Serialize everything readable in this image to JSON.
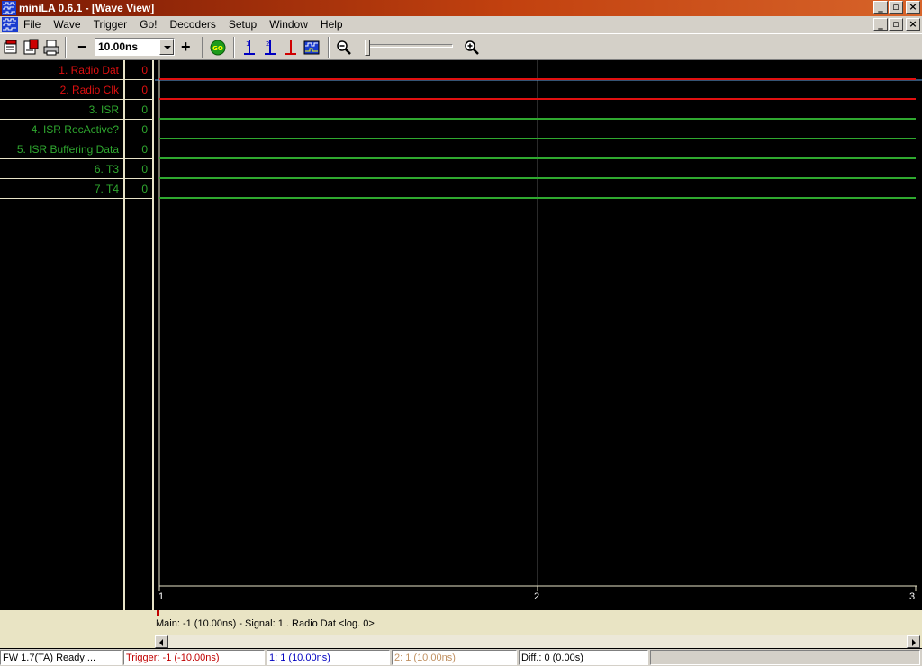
{
  "window": {
    "title": "miniLA 0.6.1 - [Wave View]",
    "buttons": {
      "minimize": "_",
      "restore": "▫",
      "close": "×"
    }
  },
  "menu": {
    "items": [
      "File",
      "Wave",
      "Trigger",
      "Go!",
      "Decoders",
      "Setup",
      "Window",
      "Help"
    ]
  },
  "toolbar": {
    "zoom_value": "10.00ns",
    "minus_label": "−",
    "plus_label": "+",
    "go_label": "GO",
    "cursor1_label": "1",
    "cursor2_label": "2"
  },
  "signals": [
    {
      "name": "1. Radio Dat",
      "value": "0",
      "color": "#e01010"
    },
    {
      "name": "2. Radio Clk",
      "value": "0",
      "color": "#e01010"
    },
    {
      "name": "3. ISR",
      "value": "0",
      "color": "#2fa82f"
    },
    {
      "name": "4. ISR RecActive?",
      "value": "0",
      "color": "#2fa82f"
    },
    {
      "name": "5. ISR Buffering Data",
      "value": "0",
      "color": "#2fa82f"
    },
    {
      "name": "6. T3",
      "value": "0",
      "color": "#2fa82f"
    },
    {
      "name": "7. T4",
      "value": "0",
      "color": "#2fa82f"
    }
  ],
  "axis": {
    "ticks": [
      "1",
      "2",
      "3"
    ]
  },
  "info_line": "Main: -1  (10.00ns) - Signal: 1 . Radio Dat <log. 0>",
  "status": {
    "fw": "FW 1.7(TA) Ready ...",
    "trigger": "Trigger: -1  (-10.00ns)",
    "cursor1": "1: 1  (10.00ns)",
    "cursor2": "2: 1  (10.00ns)",
    "diff": "Diff.: 0  (0.00s)"
  },
  "colors": {
    "title_gradient_start": "#7a1a05",
    "signal_red": "#e01010",
    "signal_green": "#2fa82f",
    "cursor1_blue": "#0000c0",
    "trigger_red": "#c00000"
  }
}
